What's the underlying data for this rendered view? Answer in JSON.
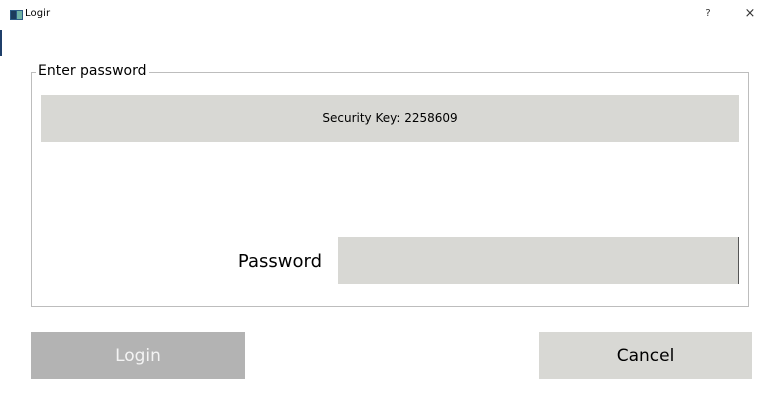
{
  "window": {
    "title": "Logir",
    "help_label": "?",
    "close_label": "×",
    "app_icon": "app-window-icon"
  },
  "group": {
    "title": "Enter password"
  },
  "security": {
    "text": "Security Key: 2258609"
  },
  "form": {
    "password_label": "Password",
    "password_value": "",
    "password_placeholder": ""
  },
  "buttons": {
    "login_label": "Login",
    "login_enabled": false,
    "cancel_label": "Cancel"
  },
  "colors": {
    "banner": "#d8d8d4",
    "disabled_button": "#b3b3b3",
    "border": "#bdbdbd"
  }
}
